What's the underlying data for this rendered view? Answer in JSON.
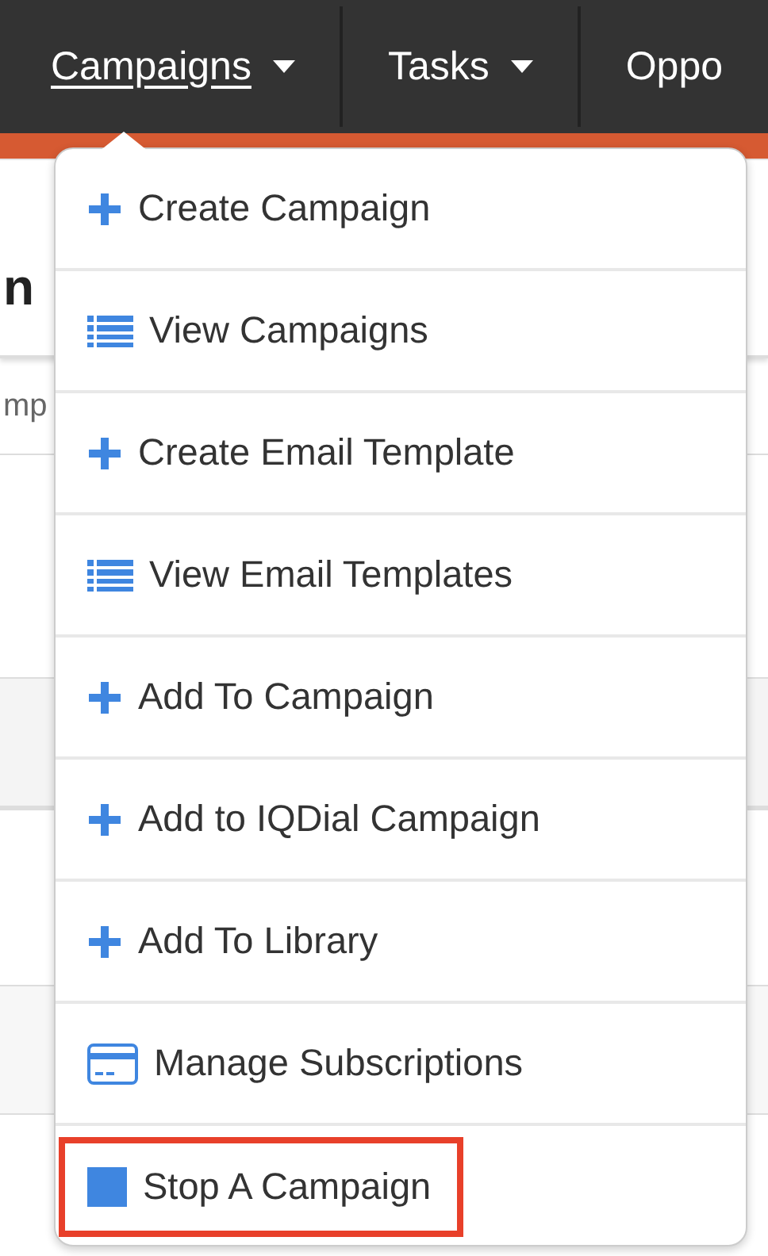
{
  "navbar": {
    "items": [
      {
        "label": "Campaigns",
        "selected": true,
        "dropdown": true
      },
      {
        "label": "Tasks",
        "selected": false,
        "dropdown": true
      },
      {
        "label": "Oppo",
        "selected": false
      }
    ]
  },
  "page": {
    "heading": "n",
    "field_value": "mp"
  },
  "menu": {
    "items": [
      {
        "kind": "plus",
        "label": "Create Campaign",
        "outlined": false
      },
      {
        "kind": "list",
        "label": "View Campaigns",
        "outlined": false
      },
      {
        "kind": "plus",
        "label": "Create Email Template",
        "outlined": false
      },
      {
        "kind": "list",
        "label": "View Email Templates",
        "outlined": false
      },
      {
        "kind": "plus",
        "label": "Add To Campaign",
        "outlined": false
      },
      {
        "kind": "plus",
        "label": "Add to IQDial Campaign",
        "outlined": false
      },
      {
        "kind": "plus",
        "label": "Add To Library",
        "outlined": false
      },
      {
        "kind": "card",
        "label": "Manage Subscriptions",
        "outlined": false
      },
      {
        "kind": "square",
        "label": "Stop A Campaign",
        "outlined": true
      }
    ]
  }
}
